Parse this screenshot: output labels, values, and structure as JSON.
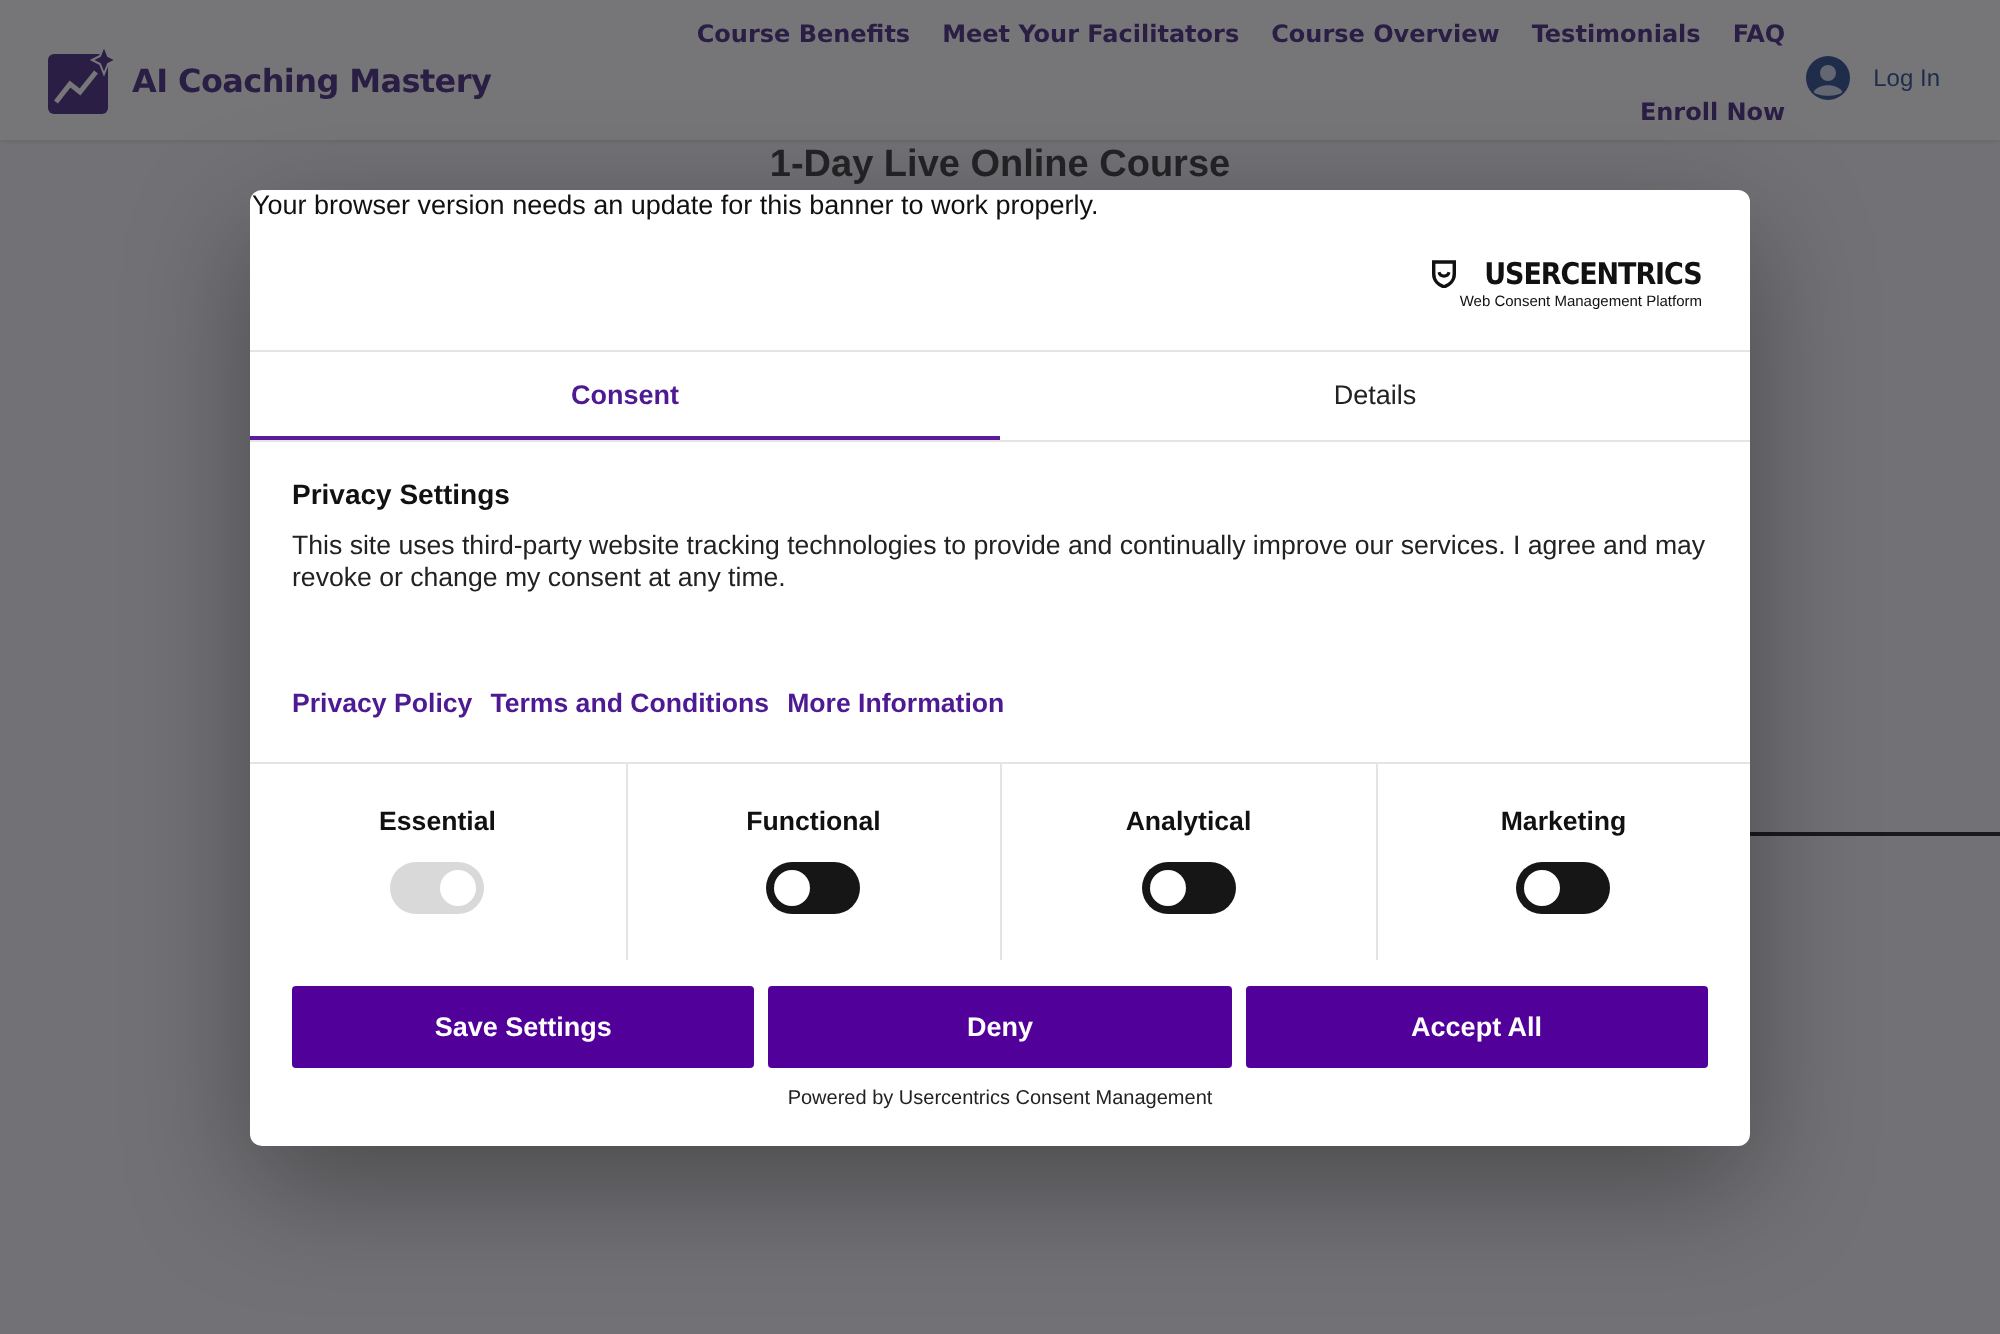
{
  "site": {
    "brand": "AI Coaching Mastery",
    "nav": [
      "Course Benefits",
      "Meet Your Facilitators",
      "Course Overview",
      "Testimonials",
      "FAQ"
    ],
    "enroll": "Enroll Now",
    "login": "Log In",
    "heading": "1-Day Live Online Course"
  },
  "consent_banner": {
    "warning": "Your browser version needs an update for this banner to work properly.",
    "logo": {
      "name": "USERCENTRICS",
      "tagline": "Web Consent Management Platform"
    },
    "tabs": [
      {
        "label": "Consent",
        "selected": true
      },
      {
        "label": "Details",
        "selected": false
      }
    ],
    "title": "Privacy Settings",
    "description": "This site uses third-party website tracking technologies to provide and continually improve our services. I agree and may revoke or change my consent at any time.",
    "links": [
      "Privacy Policy",
      "Terms and Conditions",
      "More Information"
    ],
    "categories": [
      {
        "label": "Essential",
        "checked": true,
        "disabled": true
      },
      {
        "label": "Functional",
        "checked": false,
        "disabled": false
      },
      {
        "label": "Analytical",
        "checked": false,
        "disabled": false
      },
      {
        "label": "Marketing",
        "checked": false,
        "disabled": false
      }
    ],
    "buttons": [
      "Save Settings",
      "Deny",
      "Accept All"
    ],
    "powered_by": "Powered by Usercentrics Consent Management"
  }
}
